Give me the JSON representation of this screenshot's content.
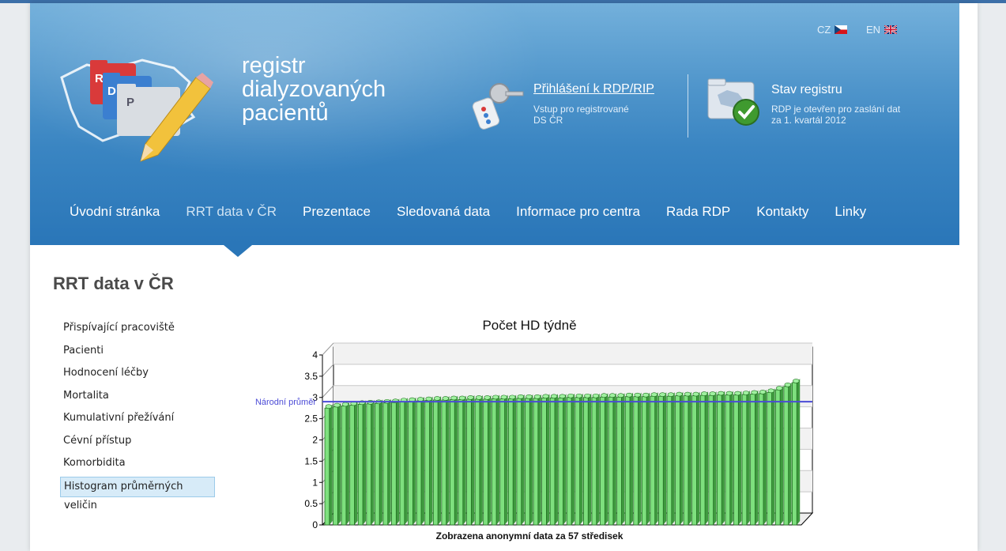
{
  "lang": {
    "cz": "CZ",
    "en": "EN"
  },
  "brand": {
    "line1": "registr",
    "line2": "dialyzovaných",
    "line3": "pacientů"
  },
  "login": {
    "title": "Přihlášení k RDP/RIP",
    "sub_line1": "Vstup pro registrované",
    "sub_line2": "DS ČR"
  },
  "status": {
    "title": "Stav registru",
    "sub_line1": "RDP je otevřen pro zaslání dat",
    "sub_line2": "za 1. kvartál 2012"
  },
  "nav": [
    {
      "label": "Úvodní stránka",
      "active": false
    },
    {
      "label": "RRT data v ČR",
      "active": true
    },
    {
      "label": "Prezentace",
      "active": false
    },
    {
      "label": "Sledovaná data",
      "active": false
    },
    {
      "label": "Informace pro centra",
      "active": false
    },
    {
      "label": "Rada RDP",
      "active": false
    },
    {
      "label": "Kontakty",
      "active": false
    },
    {
      "label": "Linky",
      "active": false
    }
  ],
  "page_title": "RRT data v ČR",
  "sidebar": [
    {
      "label": "Přispívající pracoviště",
      "active": false
    },
    {
      "label": "Pacienti",
      "active": false
    },
    {
      "label": "Hodnocení léčby",
      "active": false
    },
    {
      "label": "Mortalita",
      "active": false
    },
    {
      "label": "Kumulativní přežívání",
      "active": false
    },
    {
      "label": "Cévní přístup",
      "active": false
    },
    {
      "label": "Komorbidita",
      "active": false
    },
    {
      "label": "Histogram průměrných veličin",
      "active": true
    }
  ],
  "colors": {
    "header": "#3a85c2",
    "bar": "#7ee07e",
    "average_line": "#4b4bd6"
  },
  "chart_data": {
    "type": "bar",
    "title": "Počet HD týdně",
    "footer": "Zobrazena anonymní data za 57 středisek",
    "ylim": [
      0,
      4
    ],
    "yticks": [
      "0",
      "0.5",
      "1",
      "1.5",
      "2",
      "2.5",
      "3",
      "3.5",
      "4"
    ],
    "reference_line": {
      "label": "Národní průměr",
      "value": 2.9
    },
    "values": [
      2.75,
      2.78,
      2.8,
      2.82,
      2.84,
      2.85,
      2.86,
      2.87,
      2.88,
      2.9,
      2.91,
      2.92,
      2.93,
      2.94,
      2.94,
      2.95,
      2.95,
      2.96,
      2.96,
      2.96,
      2.97,
      2.97,
      2.97,
      2.98,
      2.98,
      2.98,
      2.99,
      2.99,
      2.99,
      3.0,
      3.0,
      3.0,
      3.0,
      3.01,
      3.01,
      3.01,
      3.02,
      3.02,
      3.02,
      3.03,
      3.03,
      3.03,
      3.04,
      3.04,
      3.04,
      3.05,
      3.05,
      3.06,
      3.06,
      3.06,
      3.07,
      3.08,
      3.09,
      3.12,
      3.18,
      3.26,
      3.35
    ]
  }
}
